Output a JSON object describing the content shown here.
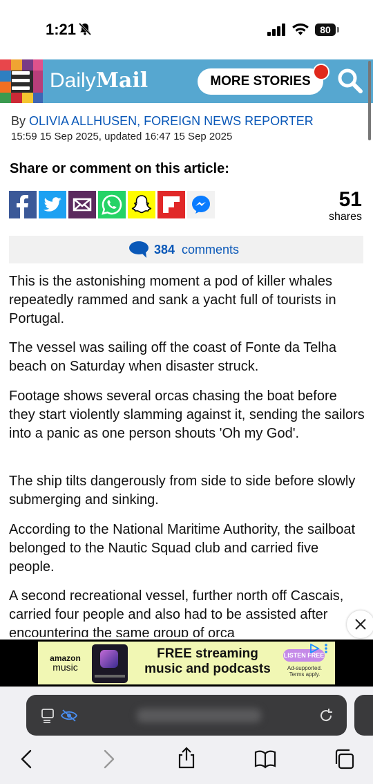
{
  "status_bar": {
    "time": "1:21",
    "battery": "80"
  },
  "header": {
    "logo_daily": "Daily",
    "logo_mail": "Mail",
    "more_stories": "MORE STORIES"
  },
  "byline": {
    "by": "By ",
    "author": "OLIVIA ALLHUSEN, FOREIGN NEWS REPORTER",
    "dates": "15:59 15 Sep 2025, updated 16:47 15 Sep 2025"
  },
  "share": {
    "title": "Share or comment on this article:",
    "count": "51",
    "count_label": "shares",
    "buttons": [
      {
        "name": "facebook",
        "color": "#3b5998"
      },
      {
        "name": "twitter",
        "color": "#1da1f2"
      },
      {
        "name": "email",
        "color": "#5b2a5e"
      },
      {
        "name": "whatsapp",
        "color": "#25d366"
      },
      {
        "name": "snapchat",
        "color": "#fffc00"
      },
      {
        "name": "flipboard",
        "color": "#e12828"
      },
      {
        "name": "messenger",
        "color": "#0a7cff"
      }
    ]
  },
  "comments": {
    "count": "384",
    "label": "comments"
  },
  "article": {
    "paragraphs": [
      "This is the astonishing moment a pod of killer whales repeatedly rammed and sank a yacht full of tourists in Portugal.",
      "The vessel was sailing off the coast of Fonte da Telha beach on Saturday when disaster struck.",
      "Footage shows several orcas chasing the boat before they start violently slamming against it, sending the sailors into a panic as one person shouts 'Oh my God'.",
      "The ship tilts dangerously from side to side before slowly submerging and sinking.",
      "According to the National Maritime Authority, the sailboat belonged to the Nautic Squad club and carried five people.",
      "A second recreational vessel, further north off Cascais, carried four people and also had to be assisted after encountering the same group of orca"
    ]
  },
  "ad": {
    "brand_top": "amazon",
    "brand_bottom": "music",
    "headline": "FREE streaming music and podcasts",
    "cta": "LISTEN FREE",
    "disclaimer": "Ad-supported. Terms apply."
  },
  "colors": {
    "header_bg": "#56a7d0",
    "link_blue": "#0a58b8",
    "ad_bg": "#f1f7b4"
  }
}
